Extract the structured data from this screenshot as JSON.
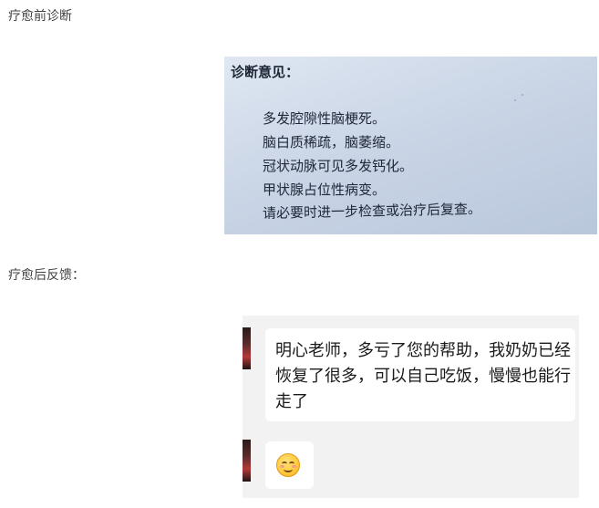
{
  "sections": {
    "before_heading": "疗愈前诊断",
    "after_heading": "疗愈后反馈："
  },
  "report": {
    "title": "诊断意见：",
    "lines": [
      "多发腔隙性脑梗死。",
      "脑白质稀疏，脑萎缩。",
      "冠状动脉可见多发钙化。",
      "甲状腺占位性病变。",
      "请必要时进一步检查或治疗后复查。"
    ]
  },
  "chat": {
    "messages": [
      {
        "text": "明心老师，多亏了您的帮助，我奶奶已经恢复了很多，可以自己吃饭，慢慢也能行走了"
      },
      {
        "emoji": "smiling-face-emoji"
      }
    ]
  }
}
